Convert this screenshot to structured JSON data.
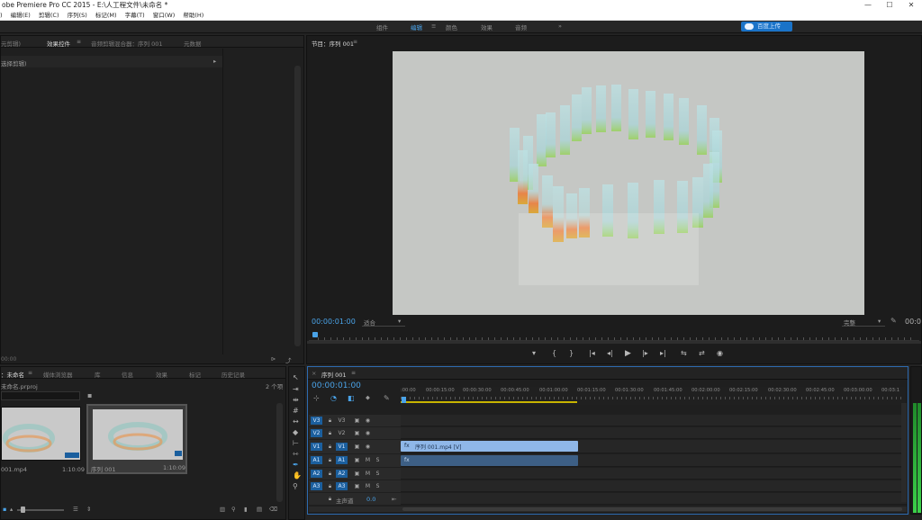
{
  "window": {
    "title": "obe Premiere Pro CC 2015 - E:\\人工程文件\\未命名 *",
    "controls": [
      "—",
      "☐",
      "✕"
    ]
  },
  "menubar": [
    ")",
    "编辑(E)",
    "剪辑(C)",
    "序列(S)",
    "标记(M)",
    "字幕(T)",
    "窗口(W)",
    "帮助(H)"
  ],
  "workspaces": {
    "items": [
      "组件",
      "编辑",
      "颜色",
      "效果",
      "音频"
    ],
    "active": "编辑",
    "menu_icon": "≡",
    "more": "»"
  },
  "cloud": {
    "label": "百度上传"
  },
  "top_left_panel": {
    "tabs": [
      "元剪辑)",
      "效果控件",
      "音频剪辑混合器：序列 001",
      "元数据"
    ],
    "active_tab": "效果控件",
    "menu_icon": "≡",
    "content_label": "选择剪辑)",
    "timecode": "00:00"
  },
  "program_monitor": {
    "title": "节目：序列 001",
    "menu_icon": "≡",
    "timecode": "00:00:01:00",
    "fit": "适合",
    "quality": "完整",
    "duration": "00:0",
    "controls": [
      "▾",
      "{",
      "}",
      "|◂",
      "◂|",
      "▶",
      "|▸",
      "▸|",
      "⇆",
      "⇄",
      "◉"
    ]
  },
  "project_panel": {
    "tabs": [
      "：未命名",
      "媒体浏览器",
      "库",
      "信息",
      "效果",
      "标记",
      "历史记录"
    ],
    "active_tab": "：未命名",
    "menu_icon": "≡",
    "file": "未命名.prproj",
    "count": "2 个项",
    "items": [
      {
        "name": "001.mp4",
        "duration": "1:10:09"
      },
      {
        "name": "序列 001",
        "duration": "1:10:09"
      }
    ]
  },
  "timeline": {
    "tab": "序列 001",
    "menu_icon": "≡",
    "close": "×",
    "timecode": "00:00:01:00",
    "ruler": [
      ":00:00",
      "00:00:15:00",
      "00:00:30:00",
      "00:00:45:00",
      "00:01:00:00",
      "00:01:15:00",
      "00:01:30:00",
      "00:01:45:00",
      "00:02:00:00",
      "00:02:15:00",
      "00:02:30:00",
      "00:02:45:00",
      "00:03:00:00",
      "00:03:1"
    ],
    "video_tracks": [
      "V3",
      "V2",
      "V1"
    ],
    "audio_tracks": [
      "A1",
      "A2",
      "A3"
    ],
    "master": {
      "label": "主声道",
      "value": "0.0"
    },
    "video_clip": "序列 001.mp4 [V]",
    "clip_icon": "fx",
    "track_letters": {
      "m": "M",
      "s": "S"
    }
  },
  "colors": {
    "accent": "#4aa3e8",
    "video_clip": "#8fb7e8",
    "audio_clip": "#3d5f85"
  }
}
